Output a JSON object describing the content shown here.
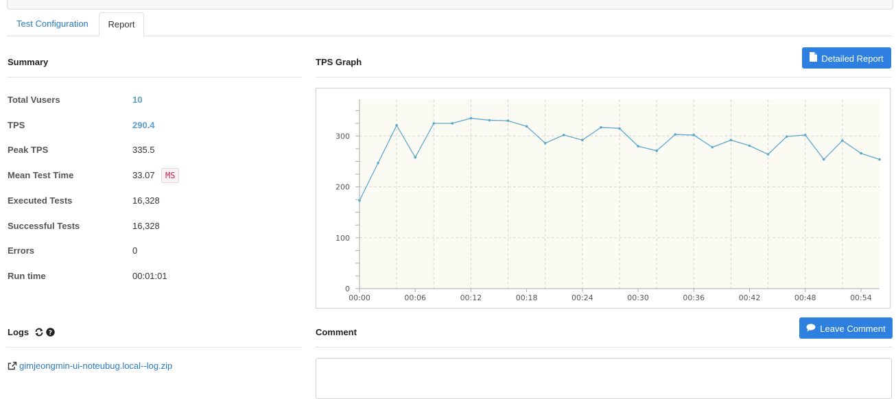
{
  "tabs": [
    {
      "label": "Test Configuration"
    },
    {
      "label": "Report"
    }
  ],
  "summary": {
    "title": "Summary",
    "rows": [
      {
        "label": "Total Vusers",
        "value": "10"
      },
      {
        "label": "TPS",
        "value": "290.4"
      },
      {
        "label": "Peak TPS",
        "value": "335.5"
      },
      {
        "label": "Mean Test Time",
        "value": "33.07",
        "unit": "MS"
      },
      {
        "label": "Executed Tests",
        "value": "16,328"
      },
      {
        "label": "Successful Tests",
        "value": "16,328"
      },
      {
        "label": "Errors",
        "value": "0"
      },
      {
        "label": "Run time",
        "value": "00:01:01"
      }
    ]
  },
  "tps": {
    "title": "TPS Graph",
    "detailed_button": "Detailed Report",
    "icon": "file-icon"
  },
  "logs": {
    "title": "Logs",
    "refresh_icon": "refresh-icon",
    "help_icon": "question-circle-icon",
    "file_link": "gimjeongmin-ui-noteubug.local--log.zip",
    "external_icon": "external-link-icon"
  },
  "comment": {
    "title": "Comment",
    "button": "Leave Comment",
    "icon": "comment-icon"
  },
  "chart_data": {
    "type": "line",
    "x": [
      "00:00",
      "00:02",
      "00:04",
      "00:06",
      "00:08",
      "00:10",
      "00:12",
      "00:14",
      "00:16",
      "00:18",
      "00:20",
      "00:22",
      "00:24",
      "00:26",
      "00:28",
      "00:30",
      "00:32",
      "00:34",
      "00:36",
      "00:38",
      "00:40",
      "00:42",
      "00:44",
      "00:46",
      "00:48",
      "00:50",
      "00:52",
      "00:54",
      "00:56"
    ],
    "series": [
      {
        "values": [
          173,
          247,
          321,
          258,
          325,
          325,
          335,
          331,
          330,
          319,
          286,
          302,
          292,
          317,
          315,
          280,
          271,
          303,
          302,
          278,
          292,
          281,
          264,
          299,
          302,
          254,
          291,
          266,
          254
        ]
      }
    ],
    "x_tick_labels": [
      "00:00",
      "00:06",
      "00:12",
      "00:18",
      "00:24",
      "00:30",
      "00:36",
      "00:42",
      "00:48",
      "00:54"
    ],
    "y_tick_labels": [
      "0",
      "100",
      "200",
      "300"
    ],
    "ylim": [
      0,
      372
    ],
    "grid": true,
    "color": "#5ba8cc",
    "background": "#fcfbf3"
  }
}
